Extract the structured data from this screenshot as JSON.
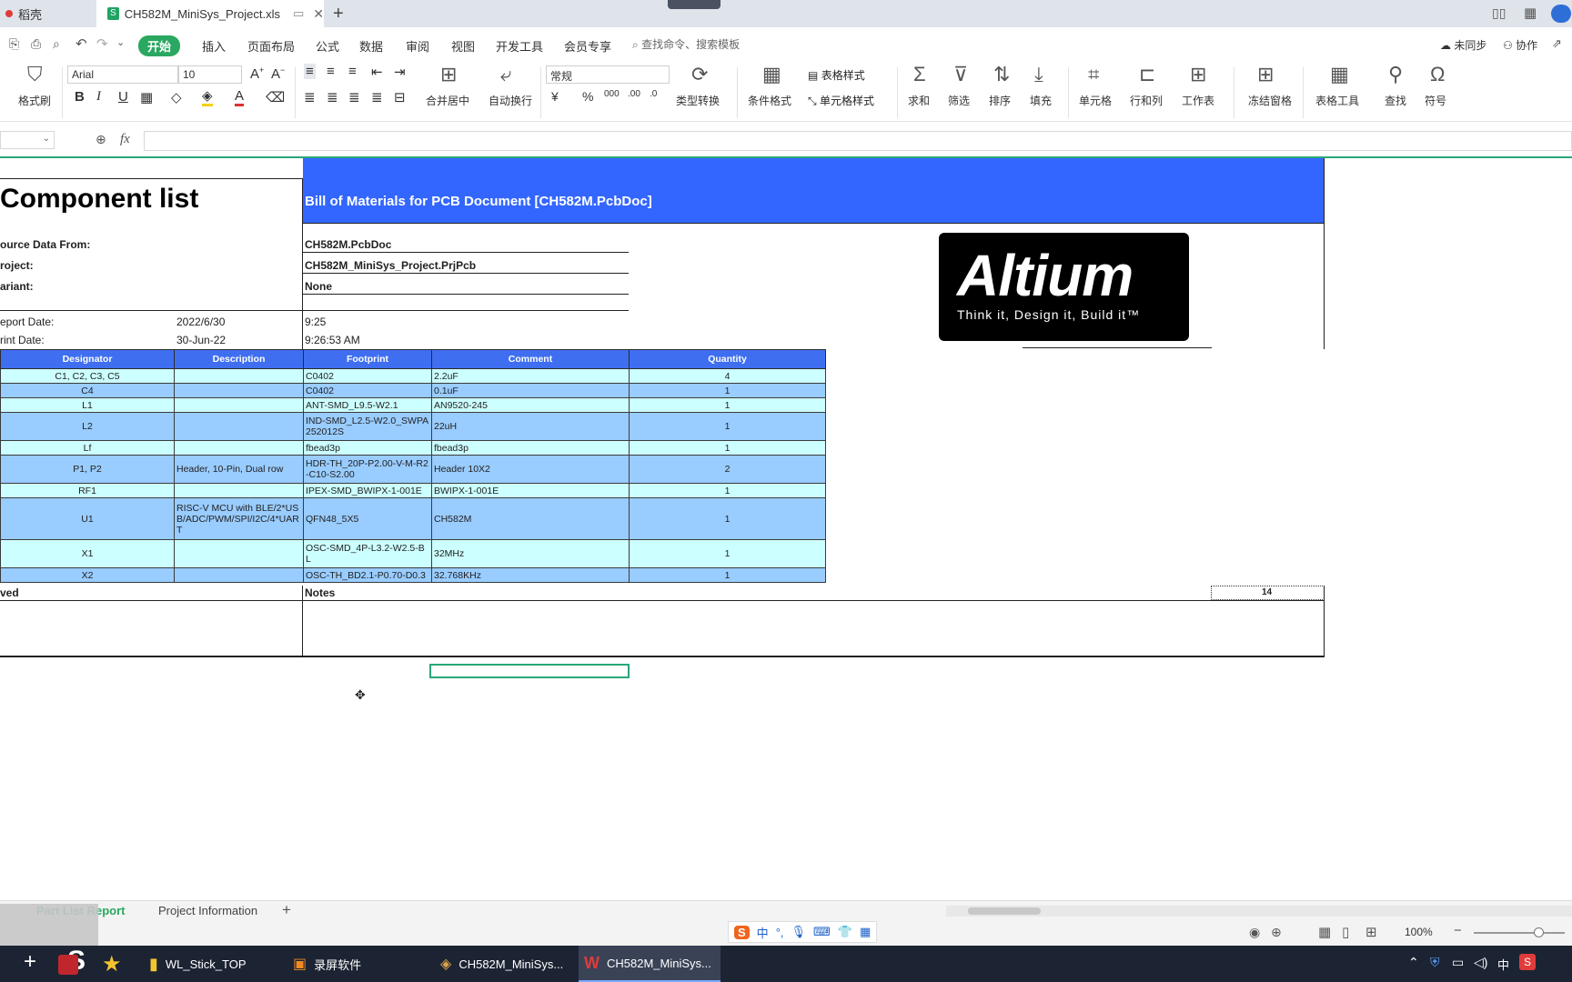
{
  "titlebar": {
    "tabs": [
      {
        "label": "稻壳"
      },
      {
        "label": "CH582M_MiniSys_Project.xls"
      }
    ]
  },
  "menubar": {
    "items": [
      "开始",
      "插入",
      "页面布局",
      "公式",
      "数据",
      "审阅",
      "视图",
      "开发工具",
      "会员专享"
    ],
    "search_placeholder": "查找命令、搜索模板",
    "sync_label": "未同步",
    "collab_label": "协作"
  },
  "ribbon": {
    "format_painter": "格式刷",
    "font_name": "Arial",
    "font_size": "10",
    "number_format": "常规",
    "merge_center": "合并居中",
    "wrap_text": "自动换行",
    "type_convert": "类型转换",
    "conditional_format": "条件格式",
    "table_style": "表格样式",
    "cell_style": "单元格样式",
    "sum": "求和",
    "filter": "筛选",
    "sort": "排序",
    "fill": "填充",
    "cell": "单元格",
    "row_col": "行和列",
    "worksheet": "工作表",
    "freeze": "冻结窗格",
    "table_tools": "表格工具",
    "find": "查找",
    "symbol": "符号"
  },
  "formula": {
    "fx": "fx",
    "value": ""
  },
  "sheet": {
    "title": "Component list",
    "banner": "Bill of Materials for PCB Document [CH582M.PcbDoc]",
    "source_label": "ource Data From:",
    "source_value": "CH582M.PcbDoc",
    "project_label": "roject:",
    "project_value": "CH582M_MiniSys_Project.PrjPcb",
    "variant_label": "ariant:",
    "variant_value": "None",
    "report_date_label": "eport Date:",
    "report_date": "2022/6/30",
    "report_time": "9:25",
    "print_date_label": "rint Date:",
    "print_date": "30-Jun-22",
    "print_time": "9:26:53 AM",
    "logo_text": "Altium",
    "logo_tagline": "Think it, Design it, Build it™",
    "columns": [
      "Designator",
      "Description",
      "Footprint",
      "Comment",
      "Quantity"
    ],
    "rows": [
      {
        "designator": "C1, C2, C3, C5",
        "description": "",
        "footprint": "C0402",
        "comment": "2.2uF",
        "quantity": "4"
      },
      {
        "designator": "C4",
        "description": "",
        "footprint": "C0402",
        "comment": "0.1uF",
        "quantity": "1"
      },
      {
        "designator": "L1",
        "description": "",
        "footprint": "ANT-SMD_L9.5-W2.1",
        "comment": "AN9520-245",
        "quantity": "1"
      },
      {
        "designator": "L2",
        "description": "",
        "footprint": "IND-SMD_L2.5-W2.0_SWPA252012S",
        "comment": "22uH",
        "quantity": "1"
      },
      {
        "designator": "Lf",
        "description": "",
        "footprint": "fbead3p",
        "comment": "fbead3p",
        "quantity": "1"
      },
      {
        "designator": "P1, P2",
        "description": "Header, 10-Pin, Dual row",
        "footprint": "HDR-TH_20P-P2.00-V-M-R2-C10-S2.00",
        "comment": "Header 10X2",
        "quantity": "2"
      },
      {
        "designator": "RF1",
        "description": "",
        "footprint": "IPEX-SMD_BWIPX-1-001E",
        "comment": "BWIPX-1-001E",
        "quantity": "1"
      },
      {
        "designator": "U1",
        "description": "RISC-V MCU with BLE/2*USB/ADC/PWM/SPI/I2C/4*UART",
        "footprint": "QFN48_5X5",
        "comment": "CH582M",
        "quantity": "1"
      },
      {
        "designator": "X1",
        "description": "",
        "footprint": "OSC-SMD_4P-L3.2-W2.5-BL",
        "comment": "32MHz",
        "quantity": "1"
      },
      {
        "designator": "X2",
        "description": "",
        "footprint": "OSC-TH_BD2.1-P0.70-D0.3",
        "comment": "32.768KHz",
        "quantity": "1"
      }
    ],
    "approved_label": "ved",
    "notes_label": "Notes",
    "total": "14"
  },
  "sheet_tabs": {
    "tabs": [
      "Part List Report",
      "Project Information"
    ],
    "add": "+"
  },
  "statusbar": {
    "zoom": "100%"
  },
  "taskbar": {
    "items": [
      "WL_Stick_TOP",
      "录屏软件",
      "CH582M_MiniSys...",
      "CH582M_MiniSys..."
    ],
    "ime": "中"
  },
  "colors": {
    "accent": "#2aa760",
    "banner": "#3366ff",
    "header": "#3f6ff0"
  }
}
